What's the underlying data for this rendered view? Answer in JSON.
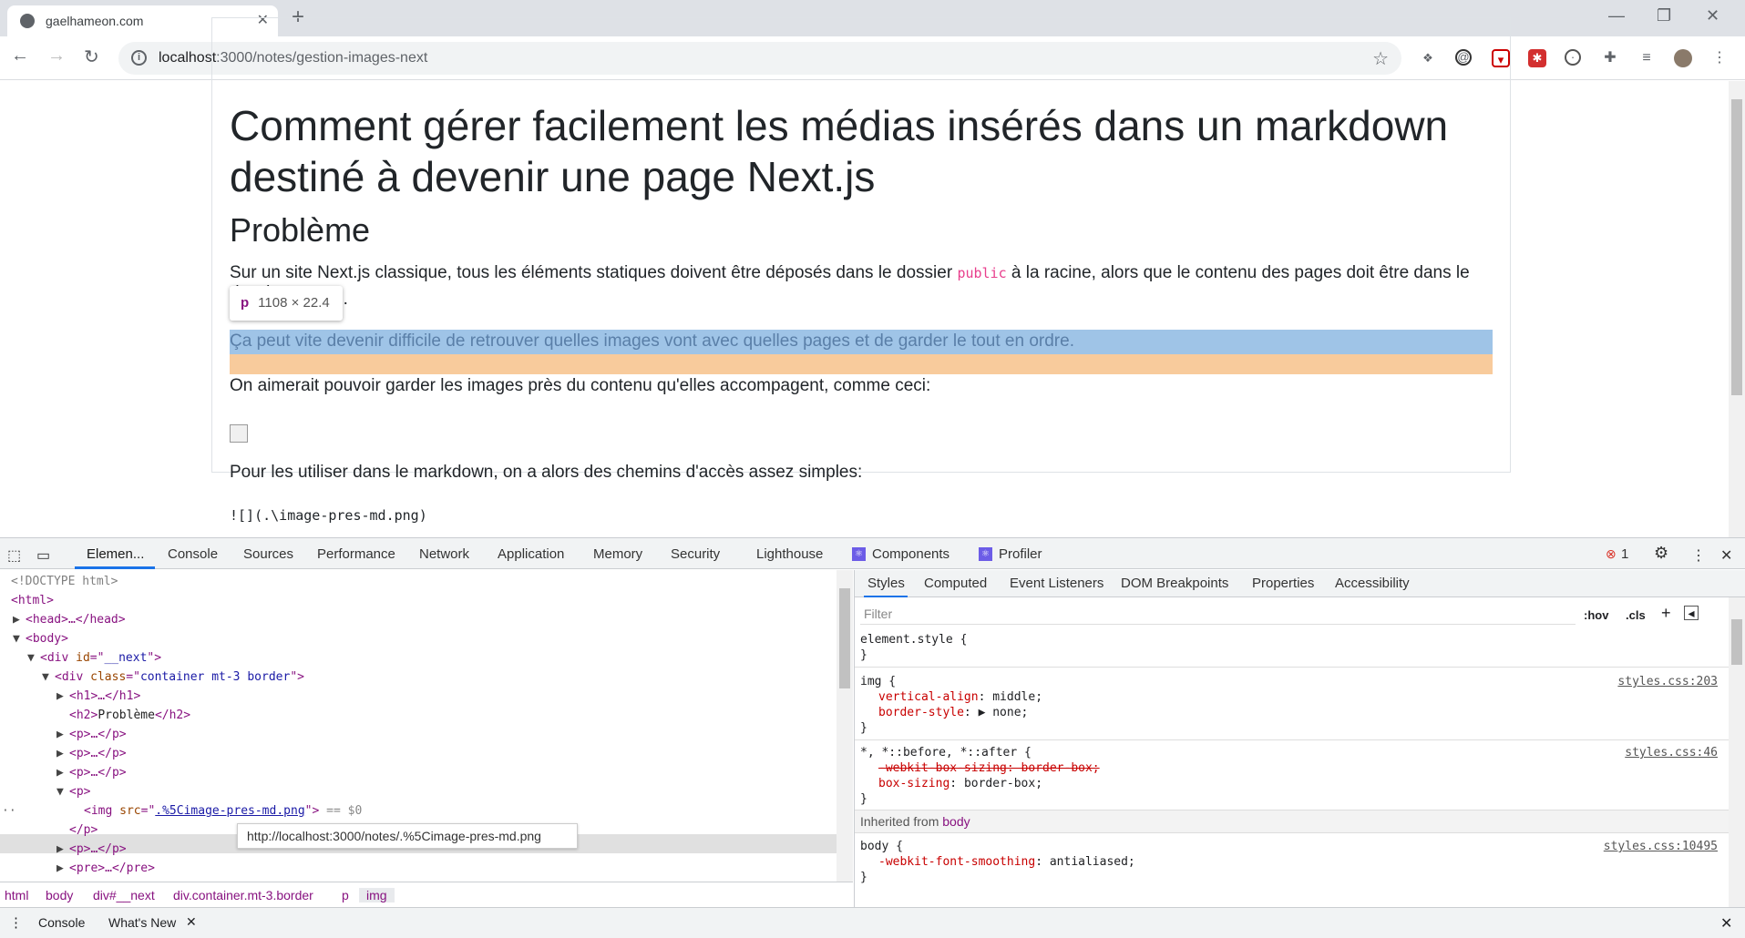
{
  "browser": {
    "tab_title": "gaelhameon.com",
    "url_host": "localhost",
    "url_path": ":3000/notes/gestion-images-next"
  },
  "page": {
    "h1": "Comment gérer facilement les médias insérés dans un markdown destiné à devenir une page Next.js",
    "h2": "Problème",
    "p1_before": "Sur un site Next.js classique, tous les éléments statiques doivent être déposés dans le dossier ",
    "p1_code": "public",
    "p1_after": " à la racine, alors que le contenu des pages doit être dans le dossier",
    "p1_line2_end": "e.",
    "p2": "Ça peut vite devenir difficile de retrouver quelles images vont avec quelles pages et de garder le tout en ordre.",
    "p3": "On aimerait pouvoir garder les images près du contenu qu'elles accompagent, comme ceci:",
    "p4": "Pour les utiliser dans le markdown, on a alors des chemins d'accès assez simples:",
    "pre": "![](.\\image-pres-md.png)",
    "inspect_tooltip_tag": "p",
    "inspect_tooltip_size": "1108 × 22.4"
  },
  "devtools": {
    "tabs": [
      "Elemen...",
      "Console",
      "Sources",
      "Performance",
      "Network",
      "Application",
      "Memory",
      "Security",
      "Lighthouse",
      "Components",
      "Profiler"
    ],
    "error_count": "1",
    "dom_lines": {
      "doctype": "<!DOCTYPE html>",
      "html": "<html>",
      "head": "<head>…</head>",
      "body": "<body>",
      "div_next": "<div id=\"__next\">",
      "div_container": "<div class=\"container mt-3 border\">",
      "h1": "<h1>…</h1>",
      "h2": "<h2>Problème</h2>",
      "p1": "<p>…</p>",
      "p2": "<p>…</p>",
      "p3": "<p>…</p>",
      "p_open": "<p>",
      "img": "<img src=\".%5Cimage-pres-md.png\"> == $0",
      "p_close": "</p>",
      "p4": "<p>…</p>",
      "pre": "<pre>…</pre>"
    },
    "url_tooltip": "http://localhost:3000/notes/.%5Cimage-pres-md.png",
    "breadcrumbs": [
      "html",
      "body",
      "div#__next",
      "div.container.mt-3.border",
      "p",
      "img"
    ],
    "styles_tabs": [
      "Styles",
      "Computed",
      "Event Listeners",
      "DOM Breakpoints",
      "Properties",
      "Accessibility"
    ],
    "filter_placeholder": "Filter",
    "hov": ":hov",
    "cls": ".cls",
    "rules": {
      "element_style": "element.style {",
      "close": "}",
      "img_selector": "img {",
      "img_prop1": "vertical-align",
      "img_val1": "middle;",
      "img_prop2": "border-style",
      "img_val2": "none;",
      "img_src": "styles.css:203",
      "star_selector": "*, *::before, *::after {",
      "star_prop1": "-webkit-box-sizing: border-box;",
      "star_prop2": "box-sizing",
      "star_val2": "border-box;",
      "star_src": "styles.css:46",
      "inherited": "Inherited from ",
      "inherited_el": "body",
      "body_selector": "body {",
      "body_prop": "-webkit-font-smoothing",
      "body_val": "antialiased;",
      "body_src": "styles.css:10495"
    },
    "drawer_tabs": [
      "Console",
      "What's New"
    ]
  }
}
